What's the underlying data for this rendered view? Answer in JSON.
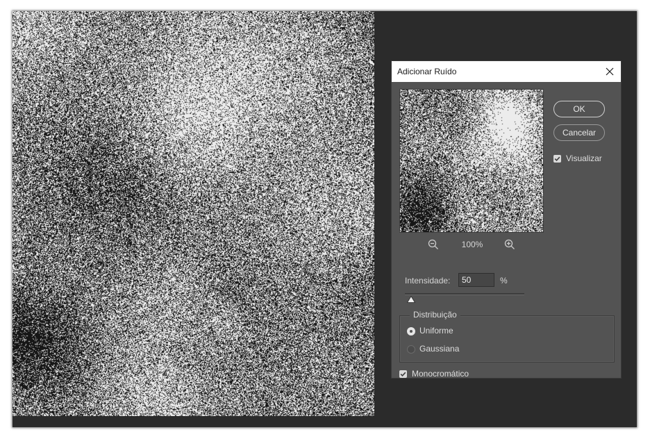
{
  "dialog": {
    "title": "Adicionar Ruído",
    "ok_label": "OK",
    "cancel_label": "Cancelar",
    "preview_checkbox": {
      "label": "Visualizar",
      "checked": true
    },
    "zoom_level": "100%",
    "intensity": {
      "label": "Intensidade:",
      "value": "50",
      "unit": "%",
      "slider_fraction": 0.05
    },
    "distribution": {
      "title": "Distribuição",
      "options": [
        {
          "label": "Uniforme",
          "selected": true
        },
        {
          "label": "Gaussiana",
          "selected": false
        }
      ]
    },
    "monochromatic": {
      "label": "Monocromático",
      "checked": true
    }
  },
  "icons": {
    "close": "close-icon",
    "zoom_out": "zoom-out-icon",
    "zoom_in": "zoom-in-icon",
    "checkmark": "checkmark-icon"
  },
  "colors": {
    "workspace": "#2b2b2b",
    "dialog_bg": "#535353",
    "titlebar_bg": "#ffffff",
    "text": "#dedede"
  }
}
